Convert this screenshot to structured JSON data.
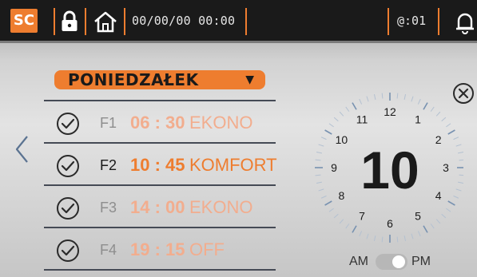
{
  "header": {
    "badge": "SC",
    "datetime": "00/00/00 00:00",
    "channel": "@:01"
  },
  "schedule": {
    "day": "PONIEDZAŁEK",
    "rows": [
      {
        "label": "F1",
        "time": "06 : 30",
        "mode": "EKONO",
        "active": false
      },
      {
        "label": "F2",
        "time": "10 : 45",
        "mode": "KOMFORT",
        "active": true
      },
      {
        "label": "F3",
        "time": "14 : 00",
        "mode": "EKONO",
        "active": false
      },
      {
        "label": "F4",
        "time": "19 : 15",
        "mode": "OFF",
        "active": false
      }
    ]
  },
  "clock": {
    "hour_value": "10",
    "numbers": [
      "12",
      "1",
      "2",
      "3",
      "4",
      "5",
      "6",
      "7",
      "8",
      "9",
      "10",
      "11"
    ]
  },
  "ampm": {
    "am": "AM",
    "pm": "PM",
    "selected": "PM"
  },
  "colors": {
    "accent": "#ee7d2f",
    "active_text": "#1a1a1a",
    "inactive_label": "#8e8e8e",
    "inactive_value": "#f2ad8e"
  }
}
